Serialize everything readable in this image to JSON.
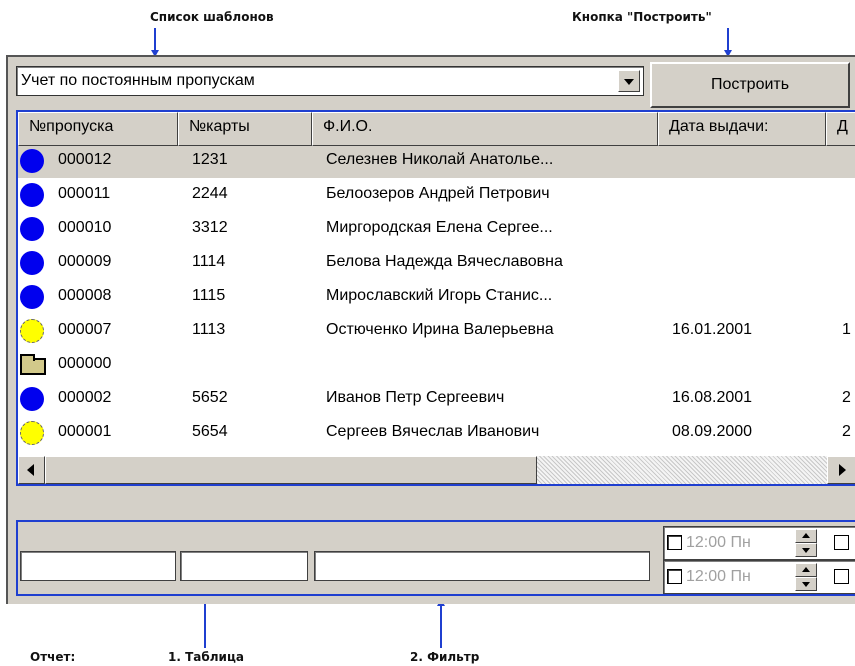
{
  "annotations": {
    "template_list": "Список шаблонов",
    "build_button": "Кнопка \"Построить\"",
    "report": "Отчет:",
    "table": "1. Таблица",
    "filter": "2. Фильтр"
  },
  "toolbar": {
    "template_value": "Учет по постоянным пропускам",
    "build_label": "Построить"
  },
  "table": {
    "columns": [
      "№пропуска",
      "№карты",
      "Ф.И.О.",
      "Дата выдачи:",
      "Д"
    ],
    "rows": [
      {
        "icon": "blue-circle-icon",
        "pass": "000012",
        "card": "1231",
        "name": "Селезнев Николай Анатолье...",
        "date": "",
        "extra": ""
      },
      {
        "icon": "blue-circle-icon",
        "pass": "000011",
        "card": "2244",
        "name": "Белоозеров Андрей Петрович",
        "date": "",
        "extra": ""
      },
      {
        "icon": "blue-circle-icon",
        "pass": "000010",
        "card": "3312",
        "name": "Миргородская Елена Сергее...",
        "date": "",
        "extra": ""
      },
      {
        "icon": "blue-circle-icon",
        "pass": "000009",
        "card": "1114",
        "name": "Белова Надежда Вячеславовна",
        "date": "",
        "extra": ""
      },
      {
        "icon": "blue-circle-icon",
        "pass": "000008",
        "card": "1115",
        "name": "Мирославский Игорь Станис...",
        "date": "",
        "extra": ""
      },
      {
        "icon": "yellow-circle-icon",
        "pass": "000007",
        "card": "1113",
        "name": "Остюченко Ирина Валерьевна",
        "date": "16.01.2001",
        "extra": "1"
      },
      {
        "icon": "folder-icon",
        "pass": "000000",
        "card": "",
        "name": "",
        "date": "",
        "extra": ""
      },
      {
        "icon": "blue-circle-icon",
        "pass": "000002",
        "card": "5652",
        "name": "Иванов Петр Сергеевич",
        "date": "16.08.2001",
        "extra": "2"
      },
      {
        "icon": "yellow-circle-icon",
        "pass": "000001",
        "card": "5654",
        "name": "Сергеев Вячеслав Иванович",
        "date": "08.09.2000",
        "extra": "2"
      }
    ]
  },
  "filter": {
    "time1": "12:00  Пн",
    "time2": "12:00  Пн"
  },
  "colors": {
    "accent": "#1f3fd0",
    "status_blue": "#0000ee",
    "status_yellow": "#ffff00"
  }
}
